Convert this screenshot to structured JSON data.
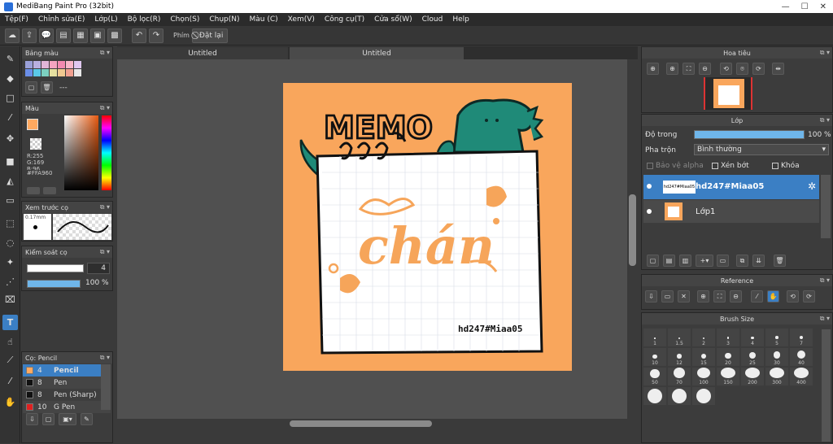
{
  "window": {
    "title": "MediBang Paint Pro (32bit)",
    "controls": [
      "—",
      "☐",
      "✕"
    ]
  },
  "menu": [
    "Tệp(F)",
    "Chỉnh sửa(E)",
    "Lớp(L)",
    "Bộ lọc(R)",
    "Chọn(S)",
    "Chụp(N)",
    "Màu (C)",
    "Xem(V)",
    "Công cụ(T)",
    "Cửa sổ(W)",
    "Cloud",
    "Help"
  ],
  "toolbar": {
    "shortcut_label": "Phím",
    "reset_label": "Đặt lại"
  },
  "tabs": [
    "Untitled",
    "Untitled"
  ],
  "palette_panel": {
    "title": "Bảng màu",
    "dash": "---"
  },
  "color_panel": {
    "title": "Màu",
    "r": "R:255",
    "g": "G:169",
    "b": "B:96",
    "hex": "#FFA960",
    "current_color": "#FFA960"
  },
  "preview_panel": {
    "title": "Xem trước cọ",
    "size": "0.17mm"
  },
  "control_panel": {
    "title": "Kiểm soát cọ",
    "size_value": "4",
    "opacity_value": "100 %",
    "opacity_level": 1.0
  },
  "brush_panel": {
    "title": "Cọ: Pencil",
    "items": [
      {
        "size": "4",
        "name": "Pencil",
        "color": "#FFA960",
        "selected": true
      },
      {
        "size": "8",
        "name": "Pen",
        "color": "#111111",
        "selected": false
      },
      {
        "size": "8",
        "name": "Pen (Sharp)",
        "color": "#111111",
        "selected": false
      },
      {
        "size": "10",
        "name": "G Pen",
        "color": "#e02020",
        "selected": false
      }
    ]
  },
  "artwork": {
    "memo_text": "MEMO",
    "chan_text": "chán",
    "signature": "hd247#Miaa05",
    "background_color": "#F9A65C",
    "accent_color": "#F6A55A"
  },
  "navigator": {
    "title": "Hoa tiêu"
  },
  "layer_panel": {
    "title": "Lớp",
    "opacity_label": "Độ trong",
    "opacity_value": "100 %",
    "opacity_level": 1.0,
    "blend_label": "Pha trộn",
    "blend_value": "Bình thường",
    "protect_alpha": "Bảo vệ alpha",
    "clipping": "Xén bớt",
    "lock": "Khóa",
    "layers": [
      {
        "name": "hd247#Miaa05",
        "selected": true
      },
      {
        "name": "Lớp1",
        "selected": false
      }
    ]
  },
  "reference_panel": {
    "title": "Reference"
  },
  "brush_size_panel": {
    "title": "Brush Size",
    "sizes": [
      "1",
      "1.5",
      "2",
      "3",
      "4",
      "5",
      "7",
      "10",
      "12",
      "15",
      "20",
      "25",
      "30",
      "40",
      "50",
      "70",
      "100",
      "150",
      "200",
      "300",
      "400",
      "",
      "",
      ""
    ]
  }
}
